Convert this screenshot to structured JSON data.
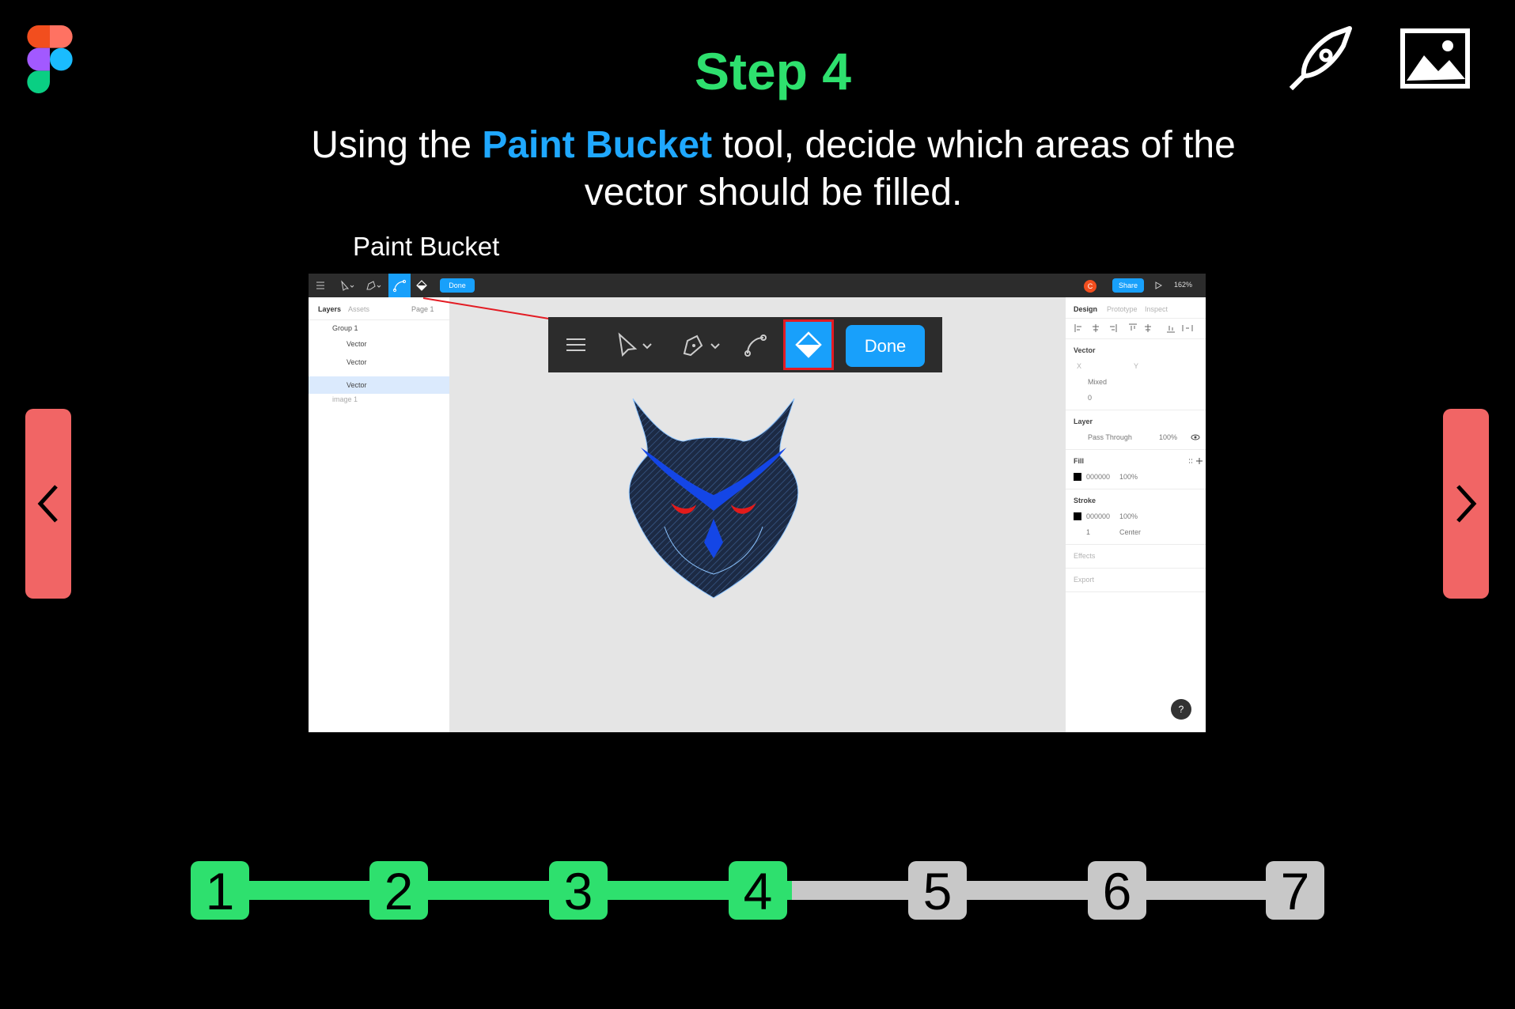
{
  "header": {
    "step_title": "Step 4",
    "instruction_before": "Using the ",
    "instruction_highlight": "Paint Bucket",
    "instruction_after": " tool, decide which areas of the vector should be filled.",
    "callout_label": "Paint Bucket"
  },
  "icons": {
    "logo": "figma-logo",
    "top_right": [
      "pen-tool-icon",
      "image-icon"
    ],
    "nav_prev": "chevron-left-icon",
    "nav_next": "chevron-right-icon"
  },
  "figma": {
    "toolbar": {
      "done_label": "Done",
      "avatar_initial": "C",
      "share_label": "Share",
      "zoom": "162%"
    },
    "layers_panel": {
      "tabs": [
        "Layers",
        "Assets"
      ],
      "page": "Page 1",
      "items": [
        "Group 1",
        "Vector",
        "Vector",
        "Vector",
        "image 1"
      ]
    },
    "design_panel": {
      "tabs": [
        "Design",
        "Prototype",
        "Inspect"
      ],
      "vector_section": "Vector",
      "x_label": "X",
      "y_label": "Y",
      "mixed_label": "Mixed",
      "radius_value": "0",
      "layer_section": "Layer",
      "blend_mode": "Pass Through",
      "layer_opacity": "100%",
      "fill_section": "Fill",
      "fill_hex": "000000",
      "fill_opacity": "100%",
      "stroke_section": "Stroke",
      "stroke_hex": "000000",
      "stroke_opacity": "100%",
      "stroke_weight": "1",
      "stroke_align": "Center",
      "effects_section": "Effects",
      "export_section": "Export",
      "help": "?"
    },
    "zoom_callout": {
      "done_label": "Done"
    }
  },
  "progress": {
    "current": 4,
    "steps": [
      "1",
      "2",
      "3",
      "4",
      "5",
      "6",
      "7"
    ],
    "colors": {
      "done": "#2ee06e",
      "todo": "#c8c8c8"
    }
  },
  "colors": {
    "title_green": "#2ee06e",
    "highlight_blue": "#1fa8ff",
    "nav_red": "#f16565",
    "figma_blue": "#18a0fb"
  }
}
